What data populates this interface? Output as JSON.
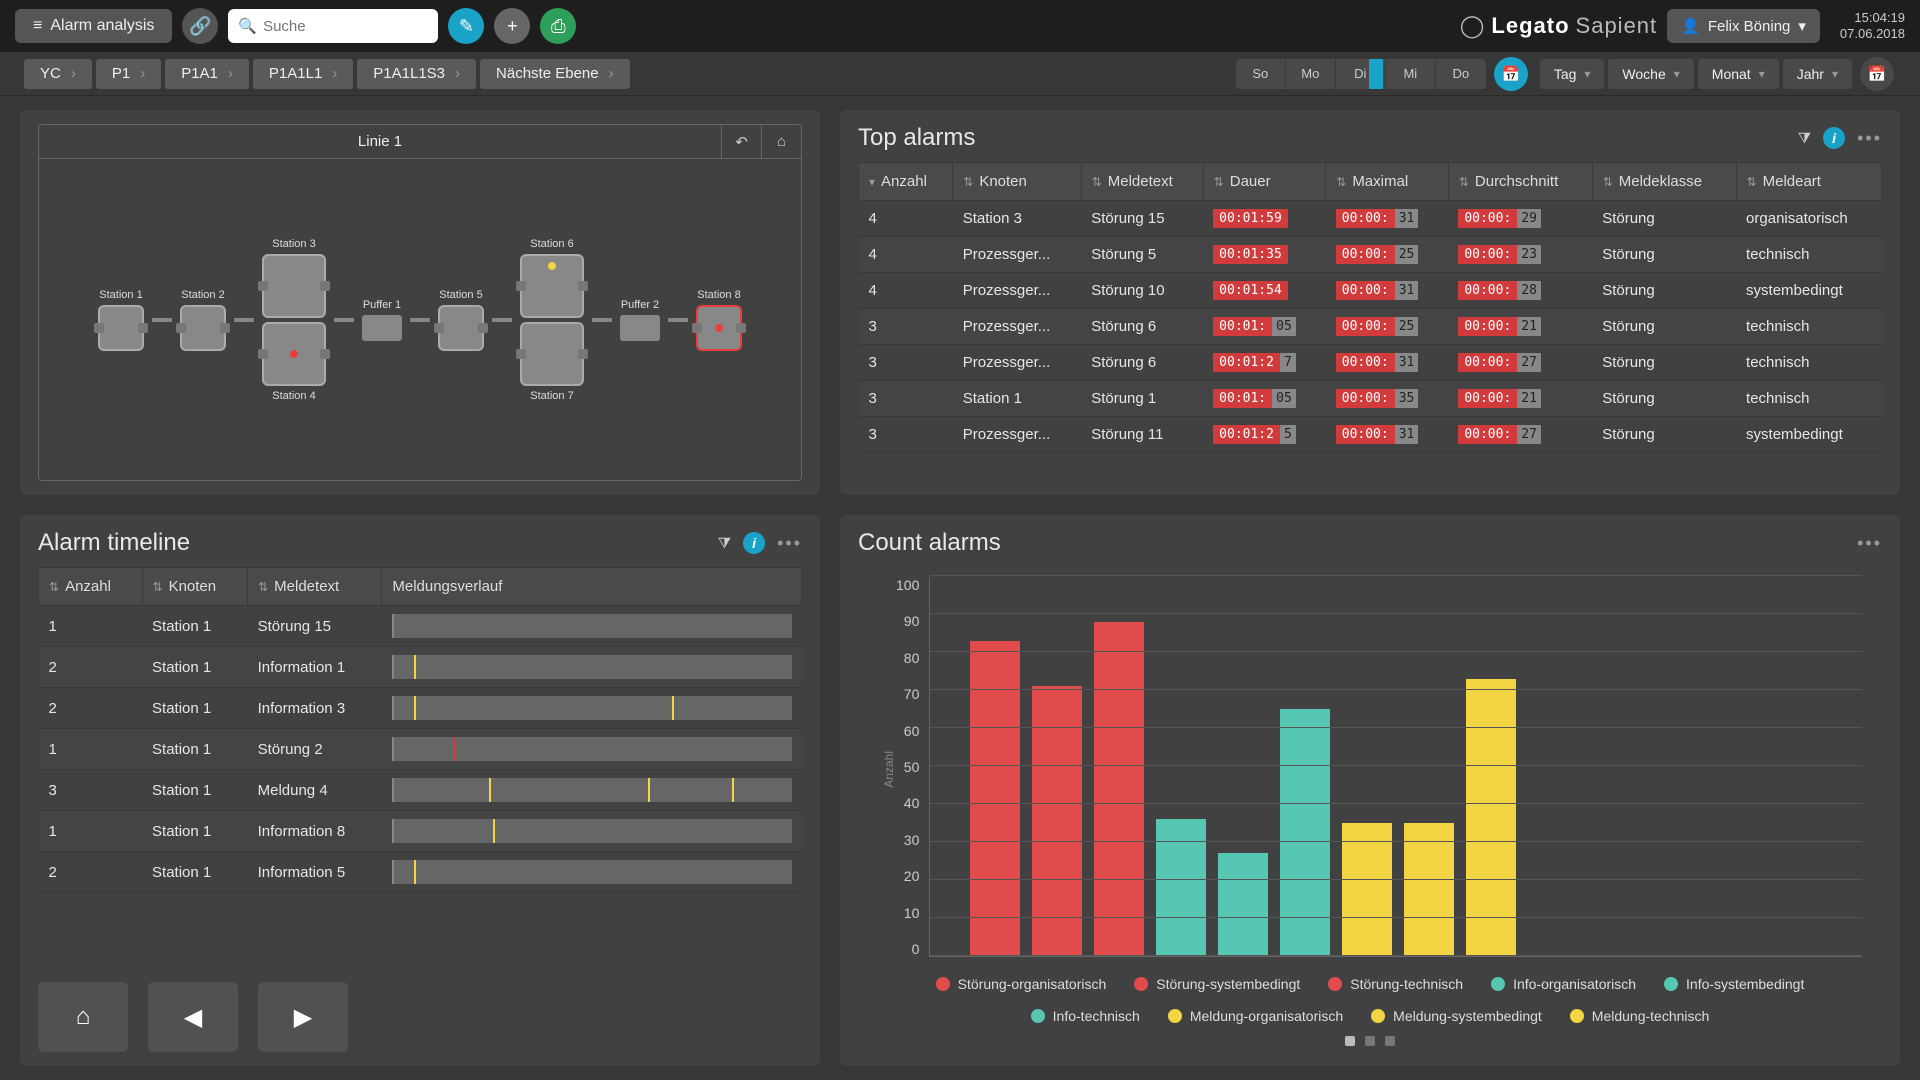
{
  "header": {
    "title": "Alarm analysis",
    "search_placeholder": "Suche",
    "logo_main": "Legato",
    "logo_sub": "Sapient",
    "user": "Felix Böning",
    "time": "15:04:19",
    "date": "07.06.2018"
  },
  "breadcrumb": {
    "items": [
      "YC",
      "P1",
      "P1A1",
      "P1A1L1",
      "P1A1L1S3"
    ],
    "next": "Nächste Ebene"
  },
  "timerange": {
    "days": [
      "So",
      "Mo",
      "Di",
      "Mi",
      "Do"
    ],
    "active_day_index": 2,
    "granularity": [
      "Tag",
      "Woche",
      "Monat",
      "Jahr"
    ]
  },
  "linie_panel": {
    "title": "Linie 1",
    "stations_top": [
      "Station 1",
      "Station 2",
      "Station 3",
      "",
      "Station 5",
      "Station 6",
      "",
      "Station 8"
    ],
    "puffers": [
      "Puffer 1",
      "Puffer 2"
    ],
    "stations_bottom": [
      "Station 4",
      "Station 7"
    ]
  },
  "top_alarms": {
    "title": "Top alarms",
    "columns": [
      "Anzahl",
      "Knoten",
      "Meldetext",
      "Dauer",
      "Maximal",
      "Durchschnitt",
      "Meldeklasse",
      "Meldeart"
    ],
    "rows": [
      {
        "anzahl": "4",
        "knoten": "Station 3",
        "meldetext": "Störung 15",
        "dauer": "00:01:59",
        "dauer_bar": "",
        "max": "00:00:",
        "max_bar": "31",
        "avg": "00:00:",
        "avg_bar": "29",
        "klasse": "Störung",
        "art": "organisatorisch"
      },
      {
        "anzahl": "4",
        "knoten": "Prozessger...",
        "meldetext": "Störung 5",
        "dauer": "00:01:35",
        "dauer_bar": "",
        "max": "00:00:",
        "max_bar": "25",
        "avg": "00:00:",
        "avg_bar": "23",
        "klasse": "Störung",
        "art": "technisch"
      },
      {
        "anzahl": "4",
        "knoten": "Prozessger...",
        "meldetext": "Störung 10",
        "dauer": "00:01:54",
        "dauer_bar": "",
        "max": "00:00:",
        "max_bar": "31",
        "avg": "00:00:",
        "avg_bar": "28",
        "klasse": "Störung",
        "art": "systembedingt"
      },
      {
        "anzahl": "3",
        "knoten": "Prozessger...",
        "meldetext": "Störung 6",
        "dauer": "00:01:",
        "dauer_bar": "05",
        "max": "00:00:",
        "max_bar": "25",
        "avg": "00:00:",
        "avg_bar": "21",
        "klasse": "Störung",
        "art": "technisch"
      },
      {
        "anzahl": "3",
        "knoten": "Prozessger...",
        "meldetext": "Störung 6",
        "dauer": "00:01:2",
        "dauer_bar": "7",
        "max": "00:00:",
        "max_bar": "31",
        "avg": "00:00:",
        "avg_bar": "27",
        "klasse": "Störung",
        "art": "technisch"
      },
      {
        "anzahl": "3",
        "knoten": "Station 1",
        "meldetext": "Störung 1",
        "dauer": "00:01:",
        "dauer_bar": "05",
        "max": "00:00:",
        "max_bar": "35",
        "avg": "00:00:",
        "avg_bar": "21",
        "klasse": "Störung",
        "art": "technisch"
      },
      {
        "anzahl": "3",
        "knoten": "Prozessger...",
        "meldetext": "Störung 11",
        "dauer": "00:01:2",
        "dauer_bar": "5",
        "max": "00:00:",
        "max_bar": "31",
        "avg": "00:00:",
        "avg_bar": "27",
        "klasse": "Störung",
        "art": "systembedingt"
      }
    ]
  },
  "alarm_timeline": {
    "title": "Alarm timeline",
    "columns": [
      "Anzahl",
      "Knoten",
      "Meldetext",
      "Meldungsverlauf"
    ],
    "rows": [
      {
        "anzahl": "1",
        "knoten": "Station 1",
        "meldetext": "Störung 15",
        "ticks": []
      },
      {
        "anzahl": "2",
        "knoten": "Station 1",
        "meldetext": "Information 1",
        "ticks": [
          5
        ]
      },
      {
        "anzahl": "2",
        "knoten": "Station 1",
        "meldetext": "Information 3",
        "ticks": [
          5,
          70
        ]
      },
      {
        "anzahl": "1",
        "knoten": "Station 1",
        "meldetext": "Störung 2",
        "ticks": [
          15
        ],
        "red": true
      },
      {
        "anzahl": "3",
        "knoten": "Station 1",
        "meldetext": "Meldung 4",
        "ticks": [
          24,
          64,
          85
        ]
      },
      {
        "anzahl": "1",
        "knoten": "Station 1",
        "meldetext": "Information 8",
        "ticks": [
          25
        ]
      },
      {
        "anzahl": "2",
        "knoten": "Station 1",
        "meldetext": "Information 5",
        "ticks": [
          5
        ]
      }
    ]
  },
  "count_alarms": {
    "title": "Count alarms",
    "ylabel": "Anzahl"
  },
  "chart_data": {
    "type": "bar",
    "categories": [
      "Störung-organisatorisch",
      "Störung-systembedingt",
      "Störung-technisch",
      "Info-organisatorisch",
      "Info-systembedingt",
      "Info-technisch",
      "Meldung-organisatorisch",
      "Meldung-systembedingt",
      "Meldung-technisch"
    ],
    "values": [
      83,
      71,
      88,
      36,
      27,
      65,
      35,
      35,
      73
    ],
    "colors": [
      "#e14b4b",
      "#e14b4b",
      "#e14b4b",
      "#55c7b3",
      "#55c7b3",
      "#55c7b3",
      "#f3d442",
      "#f3d442",
      "#f3d442"
    ],
    "ylabel": "Anzahl",
    "ylim": [
      0,
      100
    ],
    "yticks": [
      0,
      10,
      20,
      30,
      40,
      50,
      60,
      70,
      80,
      90,
      100
    ]
  }
}
